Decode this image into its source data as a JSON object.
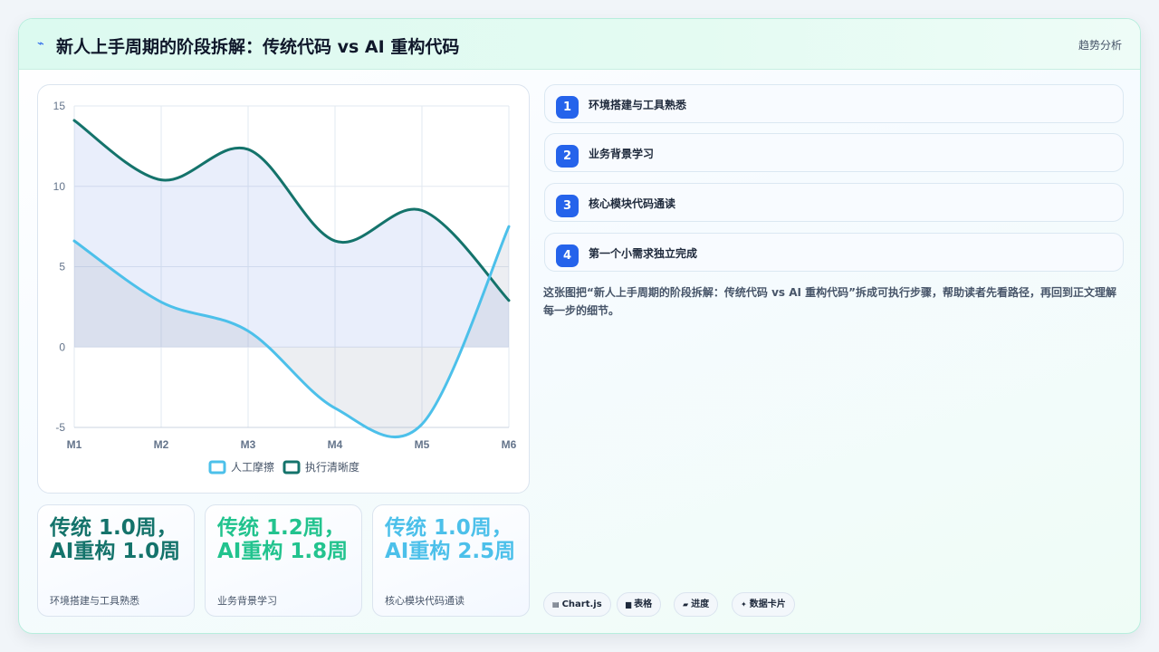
{
  "header": {
    "icon": "zap-icon",
    "title": "新人上手周期的阶段拆解：传统代码 vs AI 重构代码",
    "tag": "趋势分析"
  },
  "chart_data": {
    "type": "area",
    "categories": [
      "M1",
      "M2",
      "M3",
      "M4",
      "M5",
      "M6"
    ],
    "ylim": [
      -5,
      15
    ],
    "yticks": [
      -5,
      0,
      5,
      10,
      15
    ],
    "grid": true,
    "legend_position": "bottom",
    "series": [
      {
        "name": "人工摩擦",
        "values": [
          6.6,
          2.8,
          1.0,
          -3.8,
          -4.8,
          7.5
        ],
        "color": "#4cc0ea",
        "fill": "rgba(148,163,184,0.18)"
      },
      {
        "name": "执行清晰度",
        "values": [
          14.1,
          10.4,
          12.3,
          6.6,
          8.5,
          2.9
        ],
        "color": "#14736b",
        "fill": "rgba(99,136,230,0.14)"
      }
    ]
  },
  "stats": [
    {
      "value": "传统 1.0周，AI重构 1.0周",
      "label": "环境搭建与工具熟悉",
      "color": "#14736b"
    },
    {
      "value": "传统 1.2周，AI重构 1.8周",
      "label": "业务背景学习",
      "color": "#22c38e"
    },
    {
      "value": "传统 1.0周，AI重构 2.5周",
      "label": "核心模块代码通读",
      "color": "#4cc0ea"
    }
  ],
  "steps": [
    {
      "num": "1",
      "label": "环境搭建与工具熟悉"
    },
    {
      "num": "2",
      "label": "业务背景学习"
    },
    {
      "num": "3",
      "label": "核心模块代码通读"
    },
    {
      "num": "4",
      "label": "第一个小需求独立完成"
    }
  ],
  "description": "这张图把“新人上手周期的阶段拆解：传统代码 vs AI 重构代码”拆成可执行步骤，帮助读者先看路径，再回到正文理解每一步的细节。",
  "pills": [
    {
      "icon": "chart-icon",
      "glyph": "▤",
      "label": "Chart.js"
    },
    {
      "icon": "table-icon",
      "glyph": "▆",
      "label": "表格"
    },
    {
      "icon": "progress-icon",
      "glyph": "▰",
      "label": "进度"
    },
    {
      "icon": "sparkle-icon",
      "glyph": "✦",
      "label": "数据卡片"
    }
  ]
}
